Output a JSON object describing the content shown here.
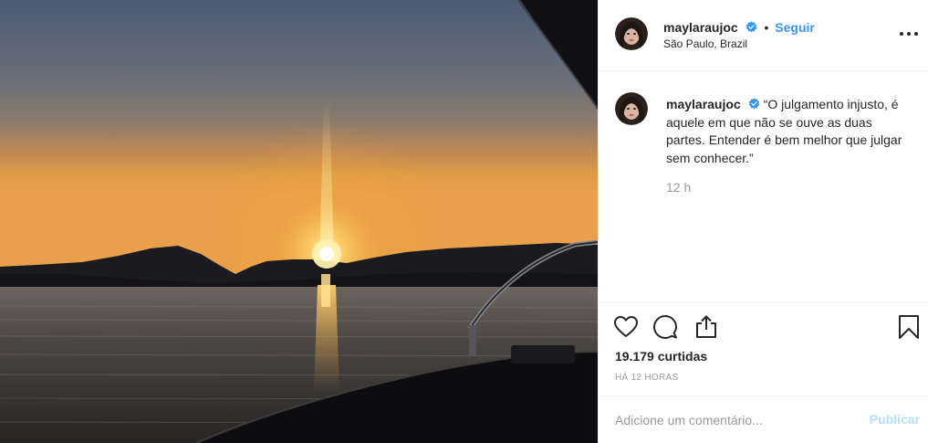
{
  "post": {
    "photo_alt": "",
    "header": {
      "username": "maylaraujoc",
      "dot": "•",
      "follow_label": "Seguir",
      "location": "São Paulo, Brazil",
      "more_icon": "more-horizontal-icon"
    },
    "caption": {
      "username": "maylaraujoc",
      "text": "“O julgamento injusto, é aquele em que não se ouve as duas partes. Entender é bem melhor que julgar sem conhecer.”",
      "time": "12 h"
    },
    "actions": {
      "like_icon": "heart-icon",
      "comment_icon": "comment-icon",
      "share_icon": "share-icon",
      "save_icon": "bookmark-icon"
    },
    "likes": "19.179 curtidas",
    "timeago": "HÁ 12 HORAS",
    "comment": {
      "placeholder": "Adicione um comentário...",
      "publish_label": "Publicar"
    }
  },
  "colors": {
    "accent": "#3897f0",
    "verified": "#3897f0",
    "muted": "#999999",
    "publish_disabled": "#b2dffc",
    "border": "#efefef"
  }
}
